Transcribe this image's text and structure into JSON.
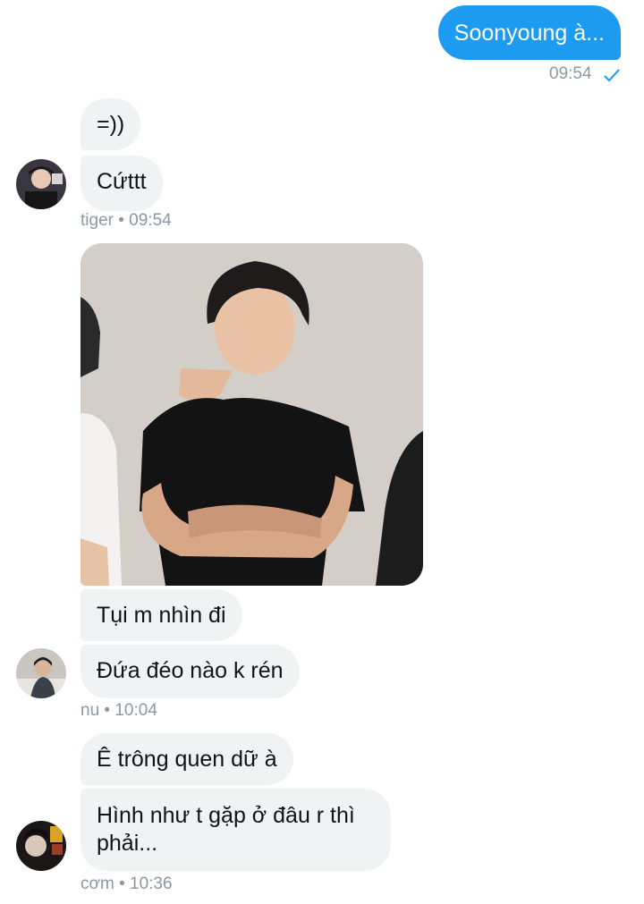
{
  "messages": {
    "outgoing": {
      "text": "Soonyoung à...",
      "time": "09:54"
    },
    "group_tiger": {
      "bubbles": [
        "=))",
        "Cứttt"
      ],
      "meta": "tiger • 09:54",
      "avatar": "avatar-tiger"
    },
    "photo": {
      "description_icon": "photo-image"
    },
    "group_nu": {
      "bubbles": [
        "Tụi m nhìn đi",
        "Đứa đéo nào k rén"
      ],
      "meta": "nu • 10:04",
      "avatar": "avatar-nu"
    },
    "group_com": {
      "bubbles": [
        "Ê trông quen dữ à",
        "Hình như t gặp ở đâu r thì phải..."
      ],
      "meta": "cơm • 10:36",
      "avatar": "avatar-com"
    }
  },
  "colors": {
    "accent": "#1d9bf0",
    "incoming_bubble": "#eff3f4",
    "meta_text": "#8b98a5"
  }
}
